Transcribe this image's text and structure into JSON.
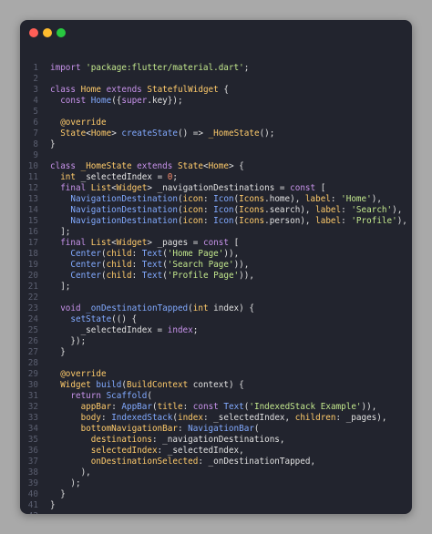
{
  "window": {
    "controls": [
      "close",
      "minimize",
      "maximize"
    ]
  },
  "colors": {
    "keyword": "#c792ea",
    "type": "#ffcb6b",
    "string": "#c3e88d",
    "function": "#82aaff",
    "number": "#f78c6c",
    "plain": "#e0e0e0",
    "line_number": "#5b5f70",
    "background": "#22242e"
  },
  "code_lines": [
    [
      {
        "c": "k",
        "t": "import "
      },
      {
        "c": "s",
        "t": "'package:flutter/material.dart'"
      },
      {
        "c": "p",
        "t": ";"
      }
    ],
    [],
    [
      {
        "c": "k",
        "t": "class "
      },
      {
        "c": "t",
        "t": "Home "
      },
      {
        "c": "k",
        "t": "extends "
      },
      {
        "c": "t",
        "t": "StatefulWidget"
      },
      {
        "c": "p",
        "t": " {"
      }
    ],
    [
      {
        "c": "p",
        "t": "  "
      },
      {
        "c": "k",
        "t": "const "
      },
      {
        "c": "f",
        "t": "Home"
      },
      {
        "c": "p",
        "t": "({"
      },
      {
        "c": "k",
        "t": "super"
      },
      {
        "c": "p",
        "t": ".key});"
      }
    ],
    [],
    [
      {
        "c": "p",
        "t": "  "
      },
      {
        "c": "a",
        "t": "@override"
      }
    ],
    [
      {
        "c": "p",
        "t": "  "
      },
      {
        "c": "t",
        "t": "State"
      },
      {
        "c": "p",
        "t": "<"
      },
      {
        "c": "t",
        "t": "Home"
      },
      {
        "c": "p",
        "t": "> "
      },
      {
        "c": "f",
        "t": "createState"
      },
      {
        "c": "p",
        "t": "() => "
      },
      {
        "c": "t",
        "t": "_HomeState"
      },
      {
        "c": "p",
        "t": "();"
      }
    ],
    [
      {
        "c": "p",
        "t": "}"
      }
    ],
    [],
    [
      {
        "c": "k",
        "t": "class "
      },
      {
        "c": "t",
        "t": "_HomeState "
      },
      {
        "c": "k",
        "t": "extends "
      },
      {
        "c": "t",
        "t": "State"
      },
      {
        "c": "p",
        "t": "<"
      },
      {
        "c": "t",
        "t": "Home"
      },
      {
        "c": "p",
        "t": "> {"
      }
    ],
    [
      {
        "c": "p",
        "t": "  "
      },
      {
        "c": "t",
        "t": "int "
      },
      {
        "c": "v",
        "t": "_selectedIndex"
      },
      {
        "c": "p",
        "t": " = "
      },
      {
        "c": "n",
        "t": "0"
      },
      {
        "c": "p",
        "t": ";"
      }
    ],
    [
      {
        "c": "p",
        "t": "  "
      },
      {
        "c": "k",
        "t": "final "
      },
      {
        "c": "t",
        "t": "List"
      },
      {
        "c": "p",
        "t": "<"
      },
      {
        "c": "t",
        "t": "Widget"
      },
      {
        "c": "p",
        "t": "> _navigationDestinations = "
      },
      {
        "c": "k",
        "t": "const "
      },
      {
        "c": "p",
        "t": "["
      }
    ],
    [
      {
        "c": "p",
        "t": "    "
      },
      {
        "c": "f",
        "t": "NavigationDestination"
      },
      {
        "c": "p",
        "t": "("
      },
      {
        "c": "t",
        "t": "icon"
      },
      {
        "c": "p",
        "t": ": "
      },
      {
        "c": "f",
        "t": "Icon"
      },
      {
        "c": "p",
        "t": "("
      },
      {
        "c": "t",
        "t": "Icons"
      },
      {
        "c": "p",
        "t": ".home), "
      },
      {
        "c": "t",
        "t": "label"
      },
      {
        "c": "p",
        "t": ": "
      },
      {
        "c": "s",
        "t": "'Home'"
      },
      {
        "c": "p",
        "t": "),"
      }
    ],
    [
      {
        "c": "p",
        "t": "    "
      },
      {
        "c": "f",
        "t": "NavigationDestination"
      },
      {
        "c": "p",
        "t": "("
      },
      {
        "c": "t",
        "t": "icon"
      },
      {
        "c": "p",
        "t": ": "
      },
      {
        "c": "f",
        "t": "Icon"
      },
      {
        "c": "p",
        "t": "("
      },
      {
        "c": "t",
        "t": "Icons"
      },
      {
        "c": "p",
        "t": ".search), "
      },
      {
        "c": "t",
        "t": "label"
      },
      {
        "c": "p",
        "t": ": "
      },
      {
        "c": "s",
        "t": "'Search'"
      },
      {
        "c": "p",
        "t": "),"
      }
    ],
    [
      {
        "c": "p",
        "t": "    "
      },
      {
        "c": "f",
        "t": "NavigationDestination"
      },
      {
        "c": "p",
        "t": "("
      },
      {
        "c": "t",
        "t": "icon"
      },
      {
        "c": "p",
        "t": ": "
      },
      {
        "c": "f",
        "t": "Icon"
      },
      {
        "c": "p",
        "t": "("
      },
      {
        "c": "t",
        "t": "Icons"
      },
      {
        "c": "p",
        "t": ".person), "
      },
      {
        "c": "t",
        "t": "label"
      },
      {
        "c": "p",
        "t": ": "
      },
      {
        "c": "s",
        "t": "'Profile'"
      },
      {
        "c": "p",
        "t": "),"
      }
    ],
    [
      {
        "c": "p",
        "t": "  ];"
      }
    ],
    [
      {
        "c": "p",
        "t": "  "
      },
      {
        "c": "k",
        "t": "final "
      },
      {
        "c": "t",
        "t": "List"
      },
      {
        "c": "p",
        "t": "<"
      },
      {
        "c": "t",
        "t": "Widget"
      },
      {
        "c": "p",
        "t": "> _pages = "
      },
      {
        "c": "k",
        "t": "const "
      },
      {
        "c": "p",
        "t": "["
      }
    ],
    [
      {
        "c": "p",
        "t": "    "
      },
      {
        "c": "f",
        "t": "Center"
      },
      {
        "c": "p",
        "t": "("
      },
      {
        "c": "t",
        "t": "child"
      },
      {
        "c": "p",
        "t": ": "
      },
      {
        "c": "f",
        "t": "Text"
      },
      {
        "c": "p",
        "t": "("
      },
      {
        "c": "s",
        "t": "'Home Page'"
      },
      {
        "c": "p",
        "t": ")),"
      }
    ],
    [
      {
        "c": "p",
        "t": "    "
      },
      {
        "c": "f",
        "t": "Center"
      },
      {
        "c": "p",
        "t": "("
      },
      {
        "c": "t",
        "t": "child"
      },
      {
        "c": "p",
        "t": ": "
      },
      {
        "c": "f",
        "t": "Text"
      },
      {
        "c": "p",
        "t": "("
      },
      {
        "c": "s",
        "t": "'Search Page'"
      },
      {
        "c": "p",
        "t": ")),"
      }
    ],
    [
      {
        "c": "p",
        "t": "    "
      },
      {
        "c": "f",
        "t": "Center"
      },
      {
        "c": "p",
        "t": "("
      },
      {
        "c": "t",
        "t": "child"
      },
      {
        "c": "p",
        "t": ": "
      },
      {
        "c": "f",
        "t": "Text"
      },
      {
        "c": "p",
        "t": "("
      },
      {
        "c": "s",
        "t": "'Profile Page'"
      },
      {
        "c": "p",
        "t": ")),"
      }
    ],
    [
      {
        "c": "p",
        "t": "  ];"
      }
    ],
    [],
    [
      {
        "c": "p",
        "t": "  "
      },
      {
        "c": "k",
        "t": "void "
      },
      {
        "c": "f",
        "t": "_onDestinationTapped"
      },
      {
        "c": "p",
        "t": "("
      },
      {
        "c": "t",
        "t": "int "
      },
      {
        "c": "p",
        "t": "index) {"
      }
    ],
    [
      {
        "c": "p",
        "t": "    "
      },
      {
        "c": "f",
        "t": "setState"
      },
      {
        "c": "p",
        "t": "(() {"
      }
    ],
    [
      {
        "c": "p",
        "t": "      _selectedIndex = "
      },
      {
        "c": "k",
        "t": "index"
      },
      {
        "c": "p",
        "t": ";"
      }
    ],
    [
      {
        "c": "p",
        "t": "    });"
      }
    ],
    [
      {
        "c": "p",
        "t": "  }"
      }
    ],
    [],
    [
      {
        "c": "p",
        "t": "  "
      },
      {
        "c": "a",
        "t": "@override"
      }
    ],
    [
      {
        "c": "p",
        "t": "  "
      },
      {
        "c": "t",
        "t": "Widget "
      },
      {
        "c": "f",
        "t": "build"
      },
      {
        "c": "p",
        "t": "("
      },
      {
        "c": "t",
        "t": "BuildContext "
      },
      {
        "c": "p",
        "t": "context) {"
      }
    ],
    [
      {
        "c": "p",
        "t": "    "
      },
      {
        "c": "k",
        "t": "return "
      },
      {
        "c": "f",
        "t": "Scaffold"
      },
      {
        "c": "p",
        "t": "("
      }
    ],
    [
      {
        "c": "p",
        "t": "      "
      },
      {
        "c": "t",
        "t": "appBar"
      },
      {
        "c": "p",
        "t": ": "
      },
      {
        "c": "f",
        "t": "AppBar"
      },
      {
        "c": "p",
        "t": "("
      },
      {
        "c": "t",
        "t": "title"
      },
      {
        "c": "p",
        "t": ": "
      },
      {
        "c": "k",
        "t": "const "
      },
      {
        "c": "f",
        "t": "Text"
      },
      {
        "c": "p",
        "t": "("
      },
      {
        "c": "s",
        "t": "'IndexedStack Example'"
      },
      {
        "c": "p",
        "t": ")),"
      }
    ],
    [
      {
        "c": "p",
        "t": "      "
      },
      {
        "c": "t",
        "t": "body"
      },
      {
        "c": "p",
        "t": ": "
      },
      {
        "c": "f",
        "t": "IndexedStack"
      },
      {
        "c": "p",
        "t": "("
      },
      {
        "c": "t",
        "t": "index"
      },
      {
        "c": "p",
        "t": ": _selectedIndex, "
      },
      {
        "c": "t",
        "t": "children"
      },
      {
        "c": "p",
        "t": ": _pages),"
      }
    ],
    [
      {
        "c": "p",
        "t": "      "
      },
      {
        "c": "t",
        "t": "bottomNavigationBar"
      },
      {
        "c": "p",
        "t": ": "
      },
      {
        "c": "f",
        "t": "NavigationBar"
      },
      {
        "c": "p",
        "t": "("
      }
    ],
    [
      {
        "c": "p",
        "t": "        "
      },
      {
        "c": "t",
        "t": "destinations"
      },
      {
        "c": "p",
        "t": ": _navigationDestinations,"
      }
    ],
    [
      {
        "c": "p",
        "t": "        "
      },
      {
        "c": "t",
        "t": "selectedIndex"
      },
      {
        "c": "p",
        "t": ": _selectedIndex,"
      }
    ],
    [
      {
        "c": "p",
        "t": "        "
      },
      {
        "c": "t",
        "t": "onDestinationSelected"
      },
      {
        "c": "p",
        "t": ": _onDestinationTapped,"
      }
    ],
    [
      {
        "c": "p",
        "t": "      ),"
      }
    ],
    [
      {
        "c": "p",
        "t": "    );"
      }
    ],
    [
      {
        "c": "p",
        "t": "  }"
      }
    ],
    [
      {
        "c": "p",
        "t": "}"
      }
    ],
    []
  ]
}
